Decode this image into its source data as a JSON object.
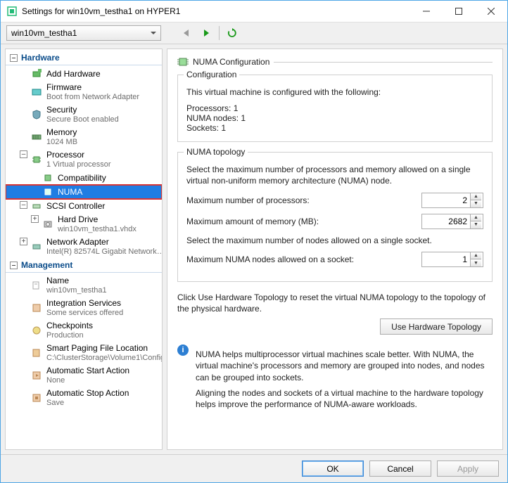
{
  "window": {
    "title": "Settings for win10vm_testha1 on HYPER1"
  },
  "toolbar": {
    "vm_name": "win10vm_testha1"
  },
  "tree": {
    "hardware_heading": "Hardware",
    "management_heading": "Management",
    "items": {
      "add_hardware": {
        "label": "Add Hardware"
      },
      "firmware": {
        "label": "Firmware",
        "sub": "Boot from Network Adapter"
      },
      "security": {
        "label": "Security",
        "sub": "Secure Boot enabled"
      },
      "memory": {
        "label": "Memory",
        "sub": "1024 MB"
      },
      "processor": {
        "label": "Processor",
        "sub": "1 Virtual processor"
      },
      "compatibility": {
        "label": "Compatibility"
      },
      "numa": {
        "label": "NUMA"
      },
      "scsi": {
        "label": "SCSI Controller"
      },
      "hdd": {
        "label": "Hard Drive",
        "sub": "win10vm_testha1.vhdx"
      },
      "net": {
        "label": "Network Adapter",
        "sub": "Intel(R) 82574L Gigabit Network C..."
      },
      "name": {
        "label": "Name",
        "sub": "win10vm_testha1"
      },
      "integration": {
        "label": "Integration Services",
        "sub": "Some services offered"
      },
      "checkpoints": {
        "label": "Checkpoints",
        "sub": "Production"
      },
      "paging": {
        "label": "Smart Paging File Location",
        "sub": "C:\\ClusterStorage\\Volume1\\Config"
      },
      "autostart": {
        "label": "Automatic Start Action",
        "sub": "None"
      },
      "autostop": {
        "label": "Automatic Stop Action",
        "sub": "Save"
      }
    }
  },
  "page": {
    "title": "NUMA Configuration",
    "config_legend": "Configuration",
    "config_line": "This virtual machine is configured with the following:",
    "processors_label": "Processors:",
    "processors_value": "1",
    "nodes_label": "NUMA nodes:",
    "nodes_value": "1",
    "sockets_label": "Sockets:",
    "sockets_value": "1",
    "topology_legend": "NUMA topology",
    "topology_intro": "Select the maximum number of processors and memory allowed on a single virtual non-uniform memory architecture (NUMA) node.",
    "max_proc_label": "Maximum number of processors:",
    "max_proc_value": "2",
    "max_mem_label": "Maximum amount of memory (MB):",
    "max_mem_value": "2682",
    "socket_intro": "Select the maximum number of nodes allowed on a single socket.",
    "max_nodes_label": "Maximum NUMA nodes allowed on a socket:",
    "max_nodes_value": "1",
    "reset_text": "Click Use Hardware Topology to reset the virtual NUMA topology to the topology of the physical hardware.",
    "use_hw_btn": "Use Hardware Topology",
    "info1": "NUMA helps multiprocessor virtual machines scale better.  With NUMA, the virtual machine's processors and memory are grouped into nodes, and nodes can be grouped into sockets.",
    "info2": "Aligning the nodes and sockets of a virtual machine to the hardware topology helps improve the performance of NUMA-aware workloads."
  },
  "buttons": {
    "ok": "OK",
    "cancel": "Cancel",
    "apply": "Apply"
  }
}
